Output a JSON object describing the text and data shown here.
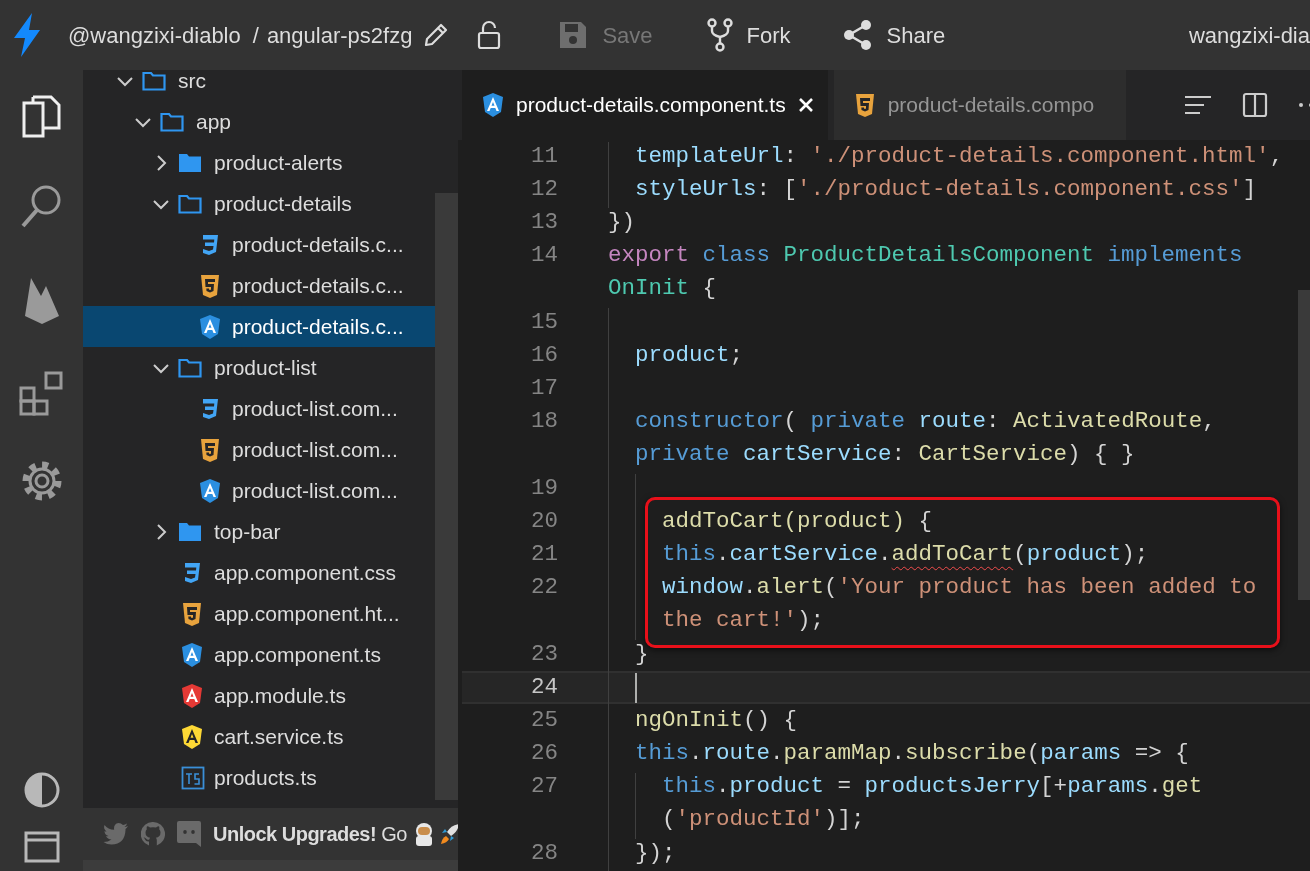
{
  "topbar": {
    "user": "@wangzixi-diablo",
    "separator": "/",
    "project": "angular-ps2fzg",
    "actions": [
      {
        "kind": "save",
        "label": "Save",
        "disabled": true
      },
      {
        "kind": "fork",
        "label": "Fork",
        "disabled": false
      },
      {
        "kind": "share",
        "label": "Share",
        "disabled": false
      }
    ],
    "account": "wangzixi-dia"
  },
  "activity_bar": {
    "items": [
      {
        "kind": "files",
        "selected": true
      },
      {
        "kind": "search",
        "selected": false
      },
      {
        "kind": "firebase",
        "selected": false
      },
      {
        "kind": "extensions",
        "selected": false
      },
      {
        "kind": "settings",
        "selected": false
      }
    ],
    "bottom_items": [
      {
        "kind": "theme"
      },
      {
        "kind": "layout"
      }
    ]
  },
  "explorer": {
    "tree": [
      {
        "name": "src",
        "kind": "folder",
        "expanded": true,
        "selected": false,
        "children": [
          {
            "name": "app",
            "kind": "folder",
            "expanded": true,
            "selected": false,
            "children": [
              {
                "name": "product-alerts",
                "kind": "folder",
                "expanded": false,
                "selected": false
              },
              {
                "name": "product-details",
                "kind": "folder",
                "expanded": true,
                "selected": false,
                "children": [
                  {
                    "name": "product-details.c...",
                    "kind": "css",
                    "selected": false
                  },
                  {
                    "name": "product-details.c...",
                    "kind": "html",
                    "selected": false
                  },
                  {
                    "name": "product-details.c...",
                    "kind": "component",
                    "selected": true
                  }
                ]
              },
              {
                "name": "product-list",
                "kind": "folder",
                "expanded": true,
                "selected": false,
                "children": [
                  {
                    "name": "product-list.com...",
                    "kind": "css",
                    "selected": false
                  },
                  {
                    "name": "product-list.com...",
                    "kind": "html",
                    "selected": false
                  },
                  {
                    "name": "product-list.com...",
                    "kind": "component",
                    "selected": false
                  }
                ]
              },
              {
                "name": "top-bar",
                "kind": "folder",
                "expanded": false,
                "selected": false
              },
              {
                "name": "app.component.css",
                "kind": "css",
                "selected": false
              },
              {
                "name": "app.component.ht...",
                "kind": "html",
                "selected": false
              },
              {
                "name": "app.component.ts",
                "kind": "component",
                "selected": false
              },
              {
                "name": "app.module.ts",
                "kind": "module",
                "selected": false
              },
              {
                "name": "cart.service.ts",
                "kind": "service",
                "selected": false
              },
              {
                "name": "products.ts",
                "kind": "typescript",
                "selected": false
              }
            ]
          }
        ]
      }
    ],
    "footer": {
      "promo": "**Unlock Upgrades!** Go"
    }
  },
  "editor": {
    "tabs": [
      {
        "label": "product-details.component.ts",
        "kind": "component",
        "selected": true
      },
      {
        "label": "product-details.compo",
        "kind": "html",
        "selected": false
      }
    ],
    "lines": [
      {
        "number": "11",
        "current": false,
        "boxed": false,
        "rows": [
          {
            "tokens": [
              {
                "text": "  templateUrl",
                "kind": "var"
              },
              {
                "text": ": ",
                "kind": "plain"
              },
              {
                "text": "'./product-details.component.html'",
                "kind": "string"
              },
              {
                "text": ",",
                "kind": "plain"
              }
            ]
          }
        ]
      },
      {
        "number": "12",
        "current": false,
        "boxed": false,
        "rows": [
          {
            "tokens": [
              {
                "text": "  styleUrls",
                "kind": "var"
              },
              {
                "text": ": [",
                "kind": "plain"
              },
              {
                "text": "'./product-details.component.css'",
                "kind": "string"
              },
              {
                "text": "]",
                "kind": "plain"
              }
            ]
          }
        ]
      },
      {
        "number": "13",
        "current": false,
        "boxed": false,
        "rows": [
          {
            "tokens": [
              {
                "text": "})",
                "kind": "plain"
              }
            ]
          }
        ]
      },
      {
        "number": "14",
        "current": false,
        "boxed": false,
        "rows": [
          {
            "tokens": [
              {
                "text": "export ",
                "kind": "keyword"
              },
              {
                "text": "class ",
                "kind": "storage"
              },
              {
                "text": "ProductDetailsComponent ",
                "kind": "type"
              },
              {
                "text": "implements",
                "kind": "storage"
              }
            ]
          },
          {
            "tokens": [
              {
                "text": "OnInit",
                "kind": "type"
              },
              {
                "text": " {",
                "kind": "plain"
              }
            ]
          }
        ]
      },
      {
        "number": "15",
        "current": false,
        "boxed": false,
        "rows": [
          {}
        ]
      },
      {
        "number": "16",
        "current": false,
        "boxed": false,
        "rows": [
          {
            "tokens": [
              {
                "text": "  product",
                "kind": "var"
              },
              {
                "text": ";",
                "kind": "plain"
              }
            ]
          }
        ]
      },
      {
        "number": "17",
        "current": false,
        "boxed": false,
        "rows": [
          {}
        ]
      },
      {
        "number": "18",
        "current": false,
        "boxed": false,
        "rows": [
          {
            "tokens": [
              {
                "text": "  constructor",
                "kind": "storage"
              },
              {
                "text": "( ",
                "kind": "plain"
              },
              {
                "text": "private ",
                "kind": "storage"
              },
              {
                "text": "route",
                "kind": "var"
              },
              {
                "text": ": ",
                "kind": "plain"
              },
              {
                "text": "ActivatedRoute",
                "kind": "class"
              },
              {
                "text": ",",
                "kind": "plain"
              }
            ]
          },
          {
            "tokens": [
              {
                "text": "  private ",
                "kind": "storage"
              },
              {
                "text": "cartService",
                "kind": "var"
              },
              {
                "text": ": ",
                "kind": "plain"
              },
              {
                "text": "CartService",
                "kind": "class"
              },
              {
                "text": ") { }",
                "kind": "plain"
              }
            ]
          }
        ]
      },
      {
        "number": "19",
        "current": false,
        "boxed": false,
        "rows": [
          {}
        ]
      },
      {
        "number": "20",
        "current": false,
        "boxed": true,
        "rows": [
          {
            "tokens": [
              {
                "text": "    addToCart(product)",
                "kind": "func"
              },
              {
                "text": " {",
                "kind": "plain"
              }
            ]
          }
        ]
      },
      {
        "number": "21",
        "current": false,
        "boxed": true,
        "rows": [
          {
            "tokens": [
              {
                "text": "    this",
                "kind": "storage"
              },
              {
                "text": ".",
                "kind": "plain"
              },
              {
                "text": "cartService",
                "kind": "var"
              },
              {
                "text": ".",
                "kind": "plain"
              },
              {
                "text": "addToCart",
                "kind": "func",
                "squiggle": true
              },
              {
                "text": "(",
                "kind": "plain"
              },
              {
                "text": "product",
                "kind": "var"
              },
              {
                "text": ");",
                "kind": "plain"
              }
            ]
          }
        ]
      },
      {
        "number": "22",
        "current": false,
        "boxed": true,
        "rows": [
          {
            "tokens": [
              {
                "text": "    window",
                "kind": "var"
              },
              {
                "text": ".",
                "kind": "plain"
              },
              {
                "text": "alert",
                "kind": "func"
              },
              {
                "text": "(",
                "kind": "plain"
              },
              {
                "text": "'Your product has been added to",
                "kind": "string"
              }
            ]
          },
          {
            "tokens": [
              {
                "text": "    the cart!'",
                "kind": "string"
              },
              {
                "text": ");",
                "kind": "plain"
              }
            ]
          }
        ]
      },
      {
        "number": "23",
        "current": false,
        "boxed": false,
        "rows": [
          {
            "tokens": [
              {
                "text": "  }",
                "kind": "plain"
              }
            ]
          }
        ]
      },
      {
        "number": "24",
        "current": true,
        "boxed": false,
        "rows": [
          {}
        ]
      },
      {
        "number": "25",
        "current": false,
        "boxed": false,
        "rows": [
          {
            "tokens": [
              {
                "text": "  ngOnInit",
                "kind": "func"
              },
              {
                "text": "() {",
                "kind": "plain"
              }
            ]
          }
        ]
      },
      {
        "number": "26",
        "current": false,
        "boxed": false,
        "rows": [
          {
            "tokens": [
              {
                "text": "  this",
                "kind": "storage"
              },
              {
                "text": ".",
                "kind": "plain"
              },
              {
                "text": "route",
                "kind": "var"
              },
              {
                "text": ".",
                "kind": "plain"
              },
              {
                "text": "paramMap",
                "kind": "func"
              },
              {
                "text": ".",
                "kind": "plain"
              },
              {
                "text": "subscribe",
                "kind": "func"
              },
              {
                "text": "(",
                "kind": "plain"
              },
              {
                "text": "params",
                "kind": "var"
              },
              {
                "text": " => {",
                "kind": "plain"
              }
            ]
          }
        ]
      },
      {
        "number": "27",
        "current": false,
        "boxed": false,
        "rows": [
          {
            "tokens": [
              {
                "text": "    this",
                "kind": "storage"
              },
              {
                "text": ".",
                "kind": "plain"
              },
              {
                "text": "product",
                "kind": "var"
              },
              {
                "text": " = ",
                "kind": "plain"
              },
              {
                "text": "productsJerry",
                "kind": "var"
              },
              {
                "text": "[+",
                "kind": "plain"
              },
              {
                "text": "params",
                "kind": "var"
              },
              {
                "text": ".",
                "kind": "plain"
              },
              {
                "text": "get",
                "kind": "func"
              }
            ]
          },
          {
            "tokens": [
              {
                "text": "    (",
                "kind": "plain"
              },
              {
                "text": "'productId'",
                "kind": "string"
              },
              {
                "text": ")];",
                "kind": "plain"
              }
            ]
          }
        ]
      },
      {
        "number": "28",
        "current": false,
        "boxed": false,
        "rows": [
          {
            "tokens": [
              {
                "text": "  });",
                "kind": "plain"
              }
            ]
          }
        ]
      }
    ]
  }
}
